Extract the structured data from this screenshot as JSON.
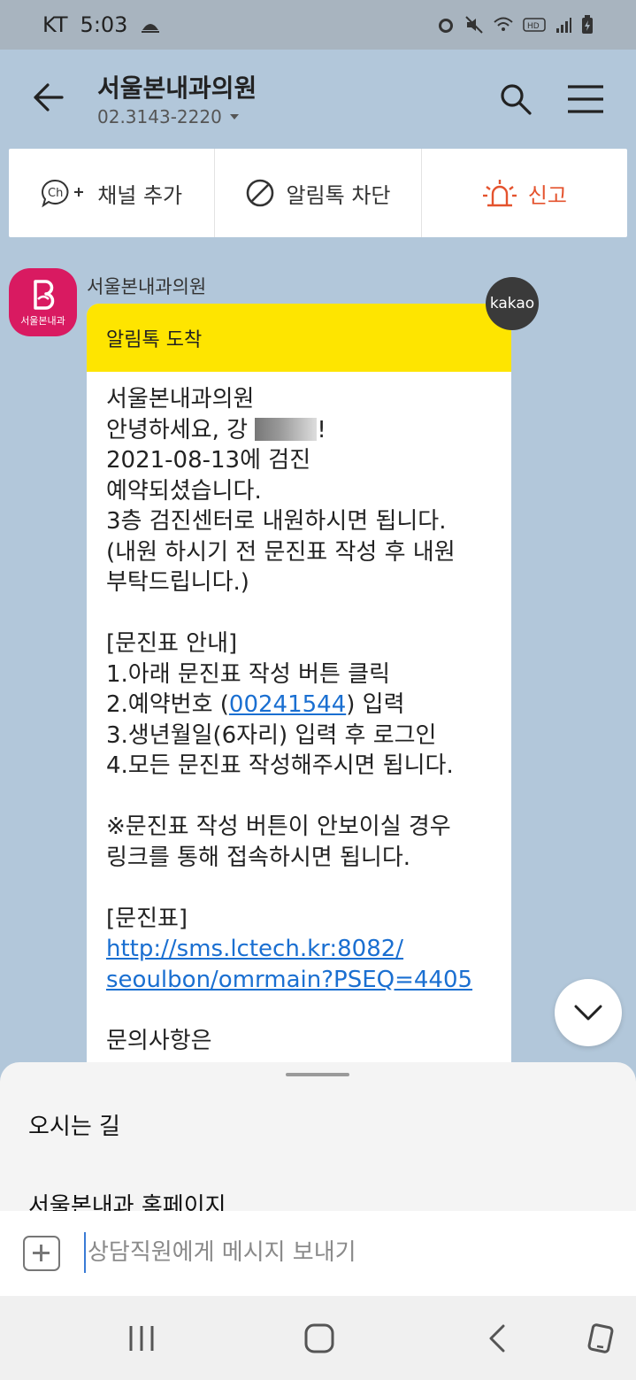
{
  "status_bar": {
    "carrier": "KT",
    "time": "5:03"
  },
  "header": {
    "title": "서울본내과의원",
    "subtitle": "02.3143-2220"
  },
  "actions": {
    "add_channel": "채널 추가",
    "block_alimtalk": "알림톡 차단",
    "report": "신고"
  },
  "chat": {
    "sender": "서울본내과의원",
    "avatar_text": "서울본내과",
    "badge": "kakao",
    "bubble_title": "알림톡 도착",
    "line1": "서울본내과의원",
    "greet_prefix": "안녕하세요, 강",
    "greet_suffix": "!",
    "date_line": "2021-08-13에 검진",
    "line4": "예약되셨습니다.",
    "line5": "3층 검진센터로 내원하시면 됩니다.",
    "line6": "(내원 하시기 전 문진표 작성 후 내원",
    "line7": "부탁드립니다.)",
    "line8": "[문진표 안내]",
    "line9": "1.아래 문진표 작성 버튼 클릭",
    "line10_prefix": "2.예약번호 (",
    "reservation_no": "00241544",
    "line10_suffix": ") 입력",
    "line11": "3.생년월일(6자리) 입력 후 로그인",
    "line12": "4.모든 문진표 작성해주시면 됩니다.",
    "line13": "※문진표 작성 버튼이 안보이실 경우",
    "line14": "링크를 통해 접속하시면 됩니다.",
    "line15": "[문진표]",
    "link1": "http://sms.lctech.kr:8082/",
    "link2": "seoulbon/omrmain?PSEQ=4405",
    "line16": "문의사항은"
  },
  "sheet": {
    "item1": "오시는 길",
    "item2": "서울본내과 홈페이지"
  },
  "input": {
    "placeholder": "상담직원에게 메시지 보내기"
  },
  "colors": {
    "accent_yellow": "#fee500",
    "brand_pink": "#d91a61",
    "report_red": "#e4532e",
    "chat_bg": "#b2c7da"
  }
}
